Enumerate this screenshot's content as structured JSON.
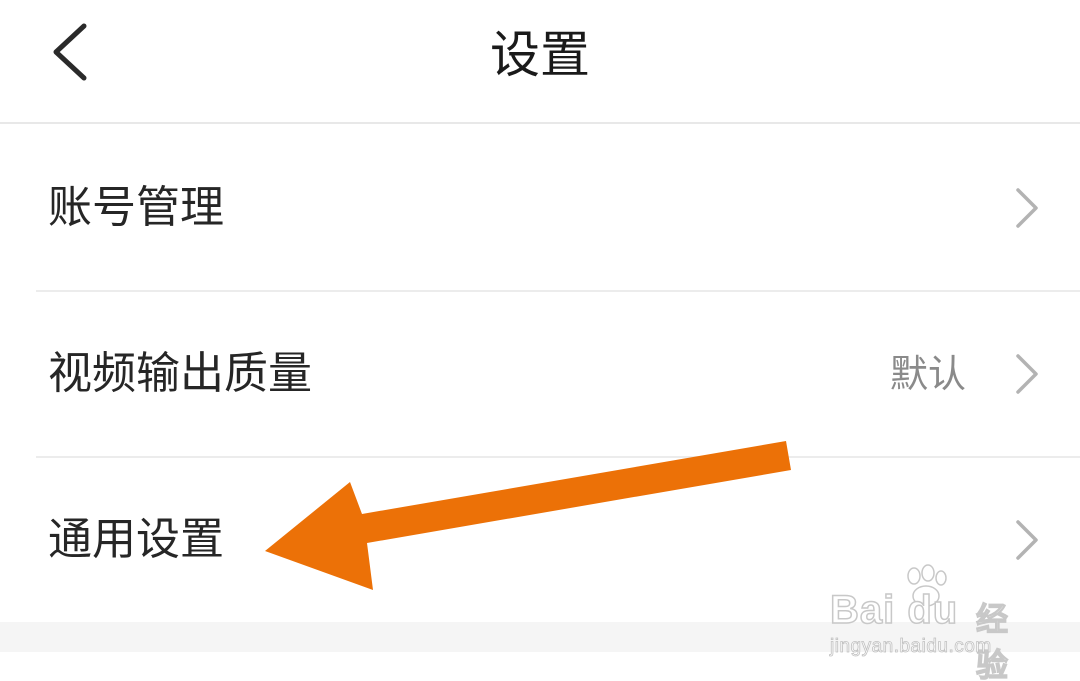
{
  "header": {
    "title": "设置",
    "back_icon": "chevron-left-icon"
  },
  "settings": {
    "items": [
      {
        "label": "账号管理",
        "value": "",
        "icon": "chevron-right-icon"
      },
      {
        "label": "视频输出质量",
        "value": "默认",
        "icon": "chevron-right-icon"
      },
      {
        "label": "通用设置",
        "value": "",
        "icon": "chevron-right-icon"
      }
    ]
  },
  "annotation": {
    "arrow_color": "#ec7107",
    "points_to": "通用设置"
  },
  "watermark": {
    "logo": "Bai du",
    "text": "经验",
    "url": "jingyan.baidu.com"
  },
  "colors": {
    "title": "#1a1a1a",
    "label": "#262626",
    "value": "#8a8a8a",
    "chevron": "#b3b3b3",
    "divider": "#ececec",
    "arrow": "#ec7107"
  }
}
